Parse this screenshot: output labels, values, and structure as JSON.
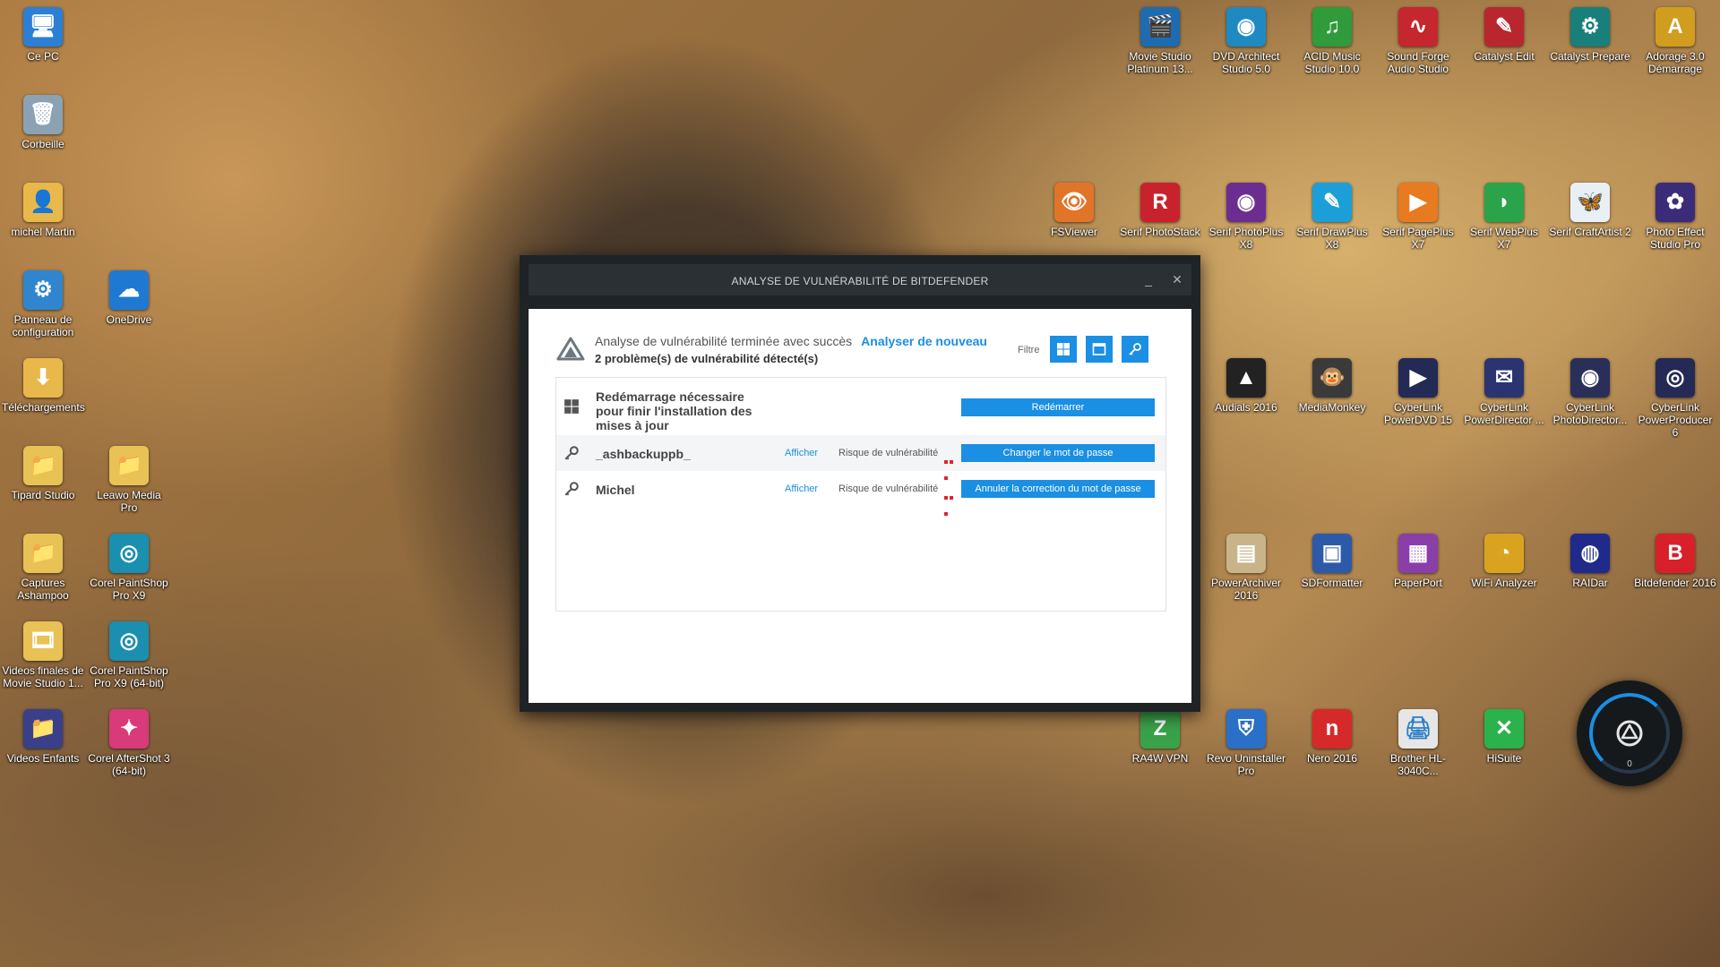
{
  "desktop": {
    "left_icons": [
      {
        "label": "Ce PC",
        "icon": "computer-icon",
        "color": "#2b7fd6",
        "glyph": "🖥"
      },
      {
        "label": "Corbeille",
        "icon": "recycle-bin-icon",
        "color": "#8aa2b4",
        "glyph": "🗑"
      },
      {
        "label": "michel Martin",
        "icon": "user-folder-icon",
        "color": "#e8b94a",
        "glyph": "👤"
      },
      {
        "label": "Panneau de configuration",
        "icon": "control-panel-icon",
        "color": "#2f86cf",
        "glyph": "⚙"
      },
      {
        "label": "OneDrive",
        "icon": "onedrive-icon",
        "color": "#1f79d2",
        "glyph": "☁"
      },
      {
        "label": "Téléchargements",
        "icon": "downloads-folder-icon",
        "color": "#e8b94a",
        "glyph": "⬇"
      },
      {
        "label": "Tipard Studio",
        "icon": "folder-icon",
        "color": "#e8c255",
        "glyph": "📁"
      },
      {
        "label": "Leawo Media Pro",
        "icon": "folder-icon",
        "color": "#e8c255",
        "glyph": "📁"
      },
      {
        "label": "Captures Ashampoo",
        "icon": "folder-icon",
        "color": "#e8c255",
        "glyph": "📁"
      },
      {
        "label": "Corel PaintShop Pro X9",
        "icon": "paintshop-icon",
        "color": "#1b8fb0",
        "glyph": "◎"
      },
      {
        "label": "Videos finales de Movie Studio 1...",
        "icon": "video-folder-icon",
        "color": "#e8c255",
        "glyph": "🎞"
      },
      {
        "label": "Corel PaintShop Pro X9 (64-bit)",
        "icon": "paintshop-icon",
        "color": "#1b8fb0",
        "glyph": "◎"
      },
      {
        "label": "Videos Enfants",
        "icon": "video-folder-icon",
        "color": "#3a3f8a",
        "glyph": "📁"
      },
      {
        "label": "Corel AfterShot 3 (64-bit)",
        "icon": "aftershot-icon",
        "color": "#d83a7a",
        "glyph": "✦"
      }
    ],
    "right_icons": [
      {
        "label": "Movie Studio Platinum 13...",
        "icon": "movie-studio-icon",
        "color": "#1e6bb0",
        "glyph": "🎬"
      },
      {
        "label": "DVD Architect Studio 5.0",
        "icon": "dvd-architect-icon",
        "color": "#1f8ac2",
        "glyph": "◉"
      },
      {
        "label": "ACID Music Studio 10.0",
        "icon": "acid-music-icon",
        "color": "#2f9b3a",
        "glyph": "♫"
      },
      {
        "label": "Sound Forge Audio Studio",
        "icon": "sound-forge-icon",
        "color": "#c6262e",
        "glyph": "∿"
      },
      {
        "label": "Catalyst Edit",
        "icon": "catalyst-edit-icon",
        "color": "#b8262e",
        "glyph": "✎"
      },
      {
        "label": "Catalyst Prepare",
        "icon": "catalyst-prepare-icon",
        "color": "#197f7a",
        "glyph": "⚙"
      },
      {
        "label": "Adorage 3.0 Démarrage",
        "icon": "adorage-icon",
        "color": "#d19d1f",
        "glyph": "A"
      },
      {
        "label": "FSViewer",
        "icon": "fsviewer-icon",
        "color": "#e0752a",
        "glyph": "👁"
      },
      {
        "label": "Serif PhotoStack",
        "icon": "serif-photostack-icon",
        "color": "#c8232c",
        "glyph": "R"
      },
      {
        "label": "Serif PhotoPlus X8",
        "icon": "serif-photoplus-icon",
        "color": "#6b2d8f",
        "glyph": "◉"
      },
      {
        "label": "Serif DrawPlus X8",
        "icon": "serif-drawplus-icon",
        "color": "#1c9fd8",
        "glyph": "✎"
      },
      {
        "label": "Serif PagePlus X7",
        "icon": "serif-pageplus-icon",
        "color": "#e87a1f",
        "glyph": "▶"
      },
      {
        "label": "Serif WebPlus X7",
        "icon": "serif-webplus-icon",
        "color": "#2aa34a",
        "glyph": "◗"
      },
      {
        "label": "Serif CraftArtist 2",
        "icon": "serif-craftartist-icon",
        "color": "#e9f0f5",
        "glyph": "🦋"
      },
      {
        "label": "Photo Effect Studio Pro",
        "icon": "photo-effect-icon",
        "color": "#3b2c7a",
        "glyph": "✿"
      },
      {
        "label": "Audials 2016",
        "icon": "audials-icon",
        "color": "#222222",
        "glyph": "▲"
      },
      {
        "label": "MediaMonkey",
        "icon": "mediamonkey-icon",
        "color": "#3a3a3a",
        "glyph": "🐵"
      },
      {
        "label": "CyberLink PowerDVD 15",
        "icon": "powerdvd-icon",
        "color": "#222a55",
        "glyph": "▶"
      },
      {
        "label": "CyberLink PowerDirector ...",
        "icon": "powerdirector-icon",
        "color": "#2a3470",
        "glyph": "✉"
      },
      {
        "label": "CyberLink PhotoDirector...",
        "icon": "photodirector-icon",
        "color": "#2a2f5a",
        "glyph": "◉"
      },
      {
        "label": "CyberLink PowerProducer 6",
        "icon": "powerproducer-icon",
        "color": "#242a55",
        "glyph": "◎"
      },
      {
        "label": "PowerArchiver 2016",
        "icon": "powerarchiver-icon",
        "color": "#c9b48a",
        "glyph": "▤"
      },
      {
        "label": "SDFormatter",
        "icon": "sdformatter-icon",
        "color": "#2d5aa8",
        "glyph": "▣"
      },
      {
        "label": "PaperPort",
        "icon": "paperport-icon",
        "color": "#8a3ea8",
        "glyph": "▦"
      },
      {
        "label": "WiFi Analyzer",
        "icon": "wifi-analyzer-icon",
        "color": "#d9a31f",
        "glyph": "◔"
      },
      {
        "label": "RAIDar",
        "icon": "raidar-icon",
        "color": "#1f2a8a",
        "glyph": "◍"
      },
      {
        "label": "Bitdefender 2016",
        "icon": "bitdefender-icon",
        "color": "#d8202a",
        "glyph": "B"
      },
      {
        "label": "RA4W VPN",
        "icon": "ra4w-vpn-icon",
        "color": "#3aa34a",
        "glyph": "Z"
      },
      {
        "label": "Revo Uninstaller Pro",
        "icon": "revo-uninstaller-icon",
        "color": "#2a6fc8",
        "glyph": "⛨"
      },
      {
        "label": "Nero 2016",
        "icon": "nero-icon",
        "color": "#d62a2a",
        "glyph": "n"
      },
      {
        "label": "Brother HL-3040C...",
        "icon": "printer-icon",
        "color": "#e6e6e6",
        "glyph": "🖨"
      },
      {
        "label": "HiSuite",
        "icon": "hisuite-icon",
        "color": "#2bb24c",
        "glyph": "✕"
      }
    ]
  },
  "dialog": {
    "title": "ANALYSE DE VULNÉRABILITÉ DE BITDEFENDER",
    "minimize_glyph": "_",
    "close_glyph": "✕",
    "status": "Analyse de vulnérabilité terminée avec succès",
    "rescan_label": "Analyser de nouveau",
    "count_text": "2 problème(s) de vulnérabilité détecté(s)",
    "filter_label": "Filtre",
    "rows": [
      {
        "title": "Redémarrage nécessaire pour finir l'installation des mises à jour",
        "action": "Redémarrer"
      },
      {
        "title": "_ashbackuppb_",
        "link": "Afficher",
        "risk": "Risque de vulnérabilité",
        "action": "Changer le mot de passe"
      },
      {
        "title": "Michel",
        "link": "Afficher",
        "risk": "Risque de vulnérabilité",
        "action": "Annuler la correction du mot de passe"
      }
    ]
  },
  "widget": {
    "count": "0"
  },
  "colors": {
    "accent": "#1a8fe3",
    "risk": "#e2232a",
    "dialog_frame": "#1f2326"
  }
}
